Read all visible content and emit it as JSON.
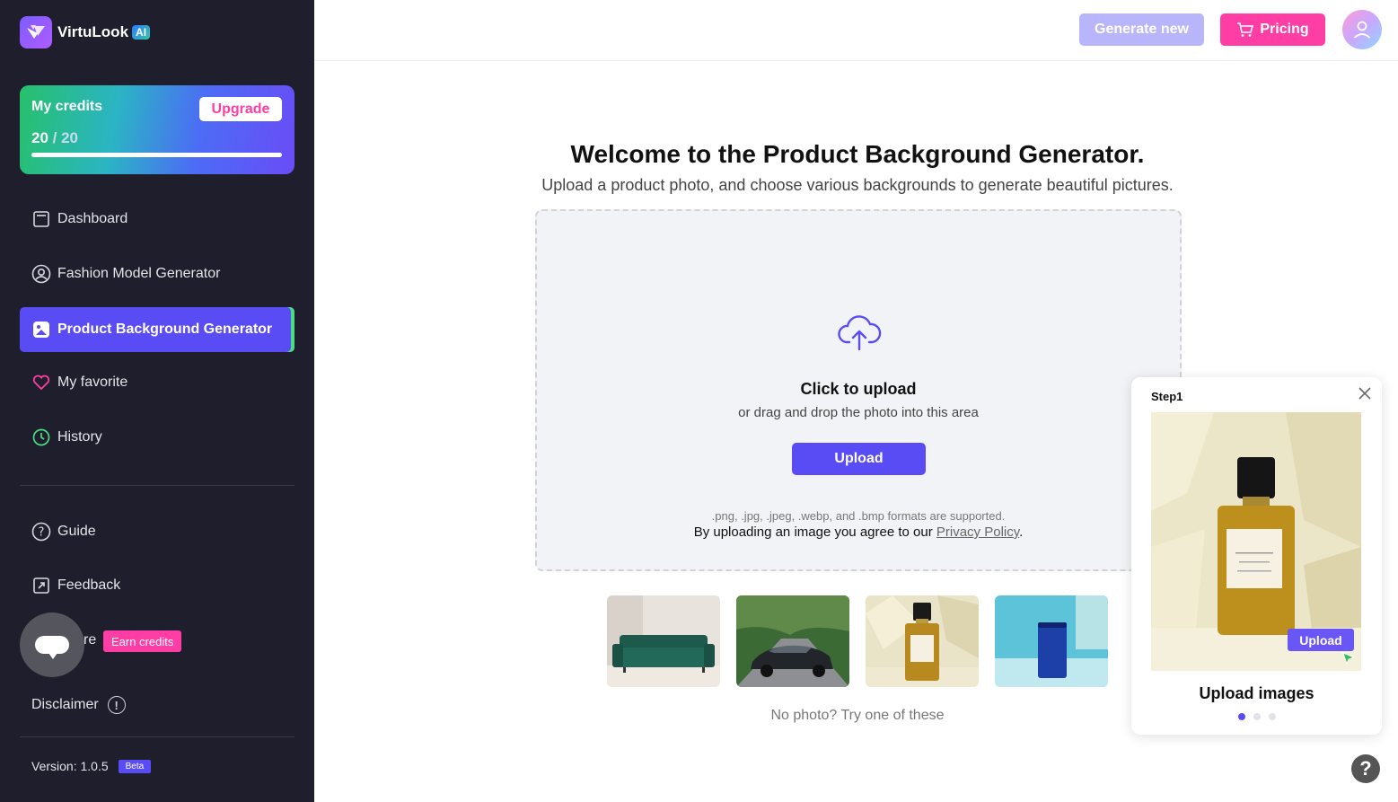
{
  "app": {
    "name": "VirtuLook",
    "badge": "AI"
  },
  "credits": {
    "title": "My credits",
    "used": "20",
    "total": "/ 20",
    "upgrade_label": "Upgrade",
    "fraction": 1.0
  },
  "sidebar": {
    "items": [
      {
        "label": "Dashboard",
        "icon": "dashboard-icon"
      },
      {
        "label": "Fashion Model Generator",
        "icon": "user-circle-icon"
      },
      {
        "label": "Product Background Generator",
        "icon": "image-edit-icon",
        "active": true
      },
      {
        "label": "My favorite",
        "icon": "heart-icon"
      },
      {
        "label": "History",
        "icon": "clock-icon"
      }
    ],
    "lower_items": [
      {
        "label": "Guide",
        "icon": "question-circle-icon"
      },
      {
        "label": "Feedback",
        "icon": "external-box-icon"
      },
      {
        "label": "re",
        "icon": "share-icon"
      }
    ],
    "earn_credits": "Earn credits",
    "disclaimer": "Disclaimer",
    "version": "Version: 1.0.5",
    "beta": "Beta"
  },
  "header": {
    "generate_new": "Generate new",
    "pricing": "Pricing"
  },
  "main": {
    "title": "Welcome to the Product Background Generator.",
    "subtitle": "Upload a product photo, and choose various backgrounds to generate beautiful pictures.",
    "click_to_upload": "Click to upload",
    "drag_text": "or drag and drop the photo into this area",
    "upload_button": "Upload",
    "formats": ".png, .jpg, .jpeg, .webp, and .bmp formats are supported.",
    "agree_prefix": "By uploading an image you agree to our ",
    "privacy_link": "Privacy Policy",
    "agree_suffix": ".",
    "samples": [
      "green-sofa",
      "dark-sedan",
      "perfume-bottle",
      "blue-cup"
    ],
    "no_photo": "No photo? Try one of these"
  },
  "guide": {
    "step": "Step1",
    "upload_label": "Upload",
    "title": "Upload images",
    "dots": 3,
    "active_dot": 0
  },
  "colors": {
    "accent": "#5a4cf5",
    "pink": "#ff3ea5",
    "sidebar_bg": "#1e1e2c"
  }
}
